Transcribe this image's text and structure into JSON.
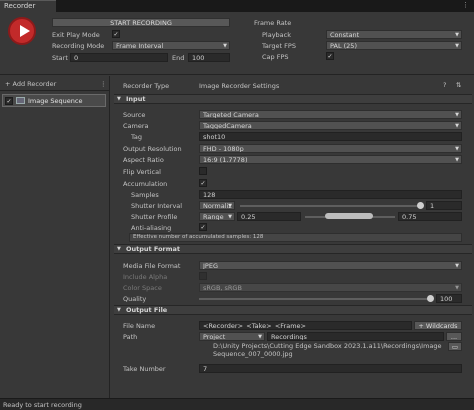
{
  "tab": {
    "title": "Recorder"
  },
  "top": {
    "start_label": "START RECORDING",
    "exit_play_mode_label": "Exit Play Mode",
    "recording_mode_label": "Recording Mode",
    "recording_mode_value": "Frame Interval",
    "start_label_short": "Start",
    "start_value": "0",
    "end_label": "End",
    "end_value": "100",
    "frame_rate_label": "Frame Rate",
    "playback_label": "Playback",
    "playback_value": "Constant",
    "target_fps_label": "Target FPS",
    "target_fps_value": "PAL (25)",
    "cap_fps_label": "Cap FPS"
  },
  "left": {
    "add_recorder": "+ Add Recorder",
    "items": [
      {
        "label": "Image Sequence"
      }
    ]
  },
  "right": {
    "recorder_type_label": "Recorder Type",
    "recorder_type_value": "Image Recorder Settings",
    "input_section": "Input",
    "source_label": "Source",
    "source_value": "Targeted Camera",
    "camera_label": "Camera",
    "camera_value": "TaggedCamera",
    "tag_label": "Tag",
    "tag_value": "shot10",
    "output_resolution_label": "Output Resolution",
    "output_resolution_value": "FHD - 1080p",
    "aspect_ratio_label": "Aspect Ratio",
    "aspect_ratio_value": "16:9 (1.7778)",
    "flip_vertical_label": "Flip Vertical",
    "accumulation_label": "Accumulation",
    "samples_label": "Samples",
    "samples_value": "128",
    "shutter_interval_label": "Shutter Interval",
    "shutter_interval_mode": "Normaliz",
    "shutter_interval_value": "1",
    "shutter_profile_label": "Shutter Profile",
    "shutter_profile_mode": "Range",
    "shutter_profile_min": "0.25",
    "shutter_profile_max": "0.75",
    "anti_aliasing_label": "Anti-aliasing",
    "accum_info": "Effective number of accumulated samples: 128",
    "output_format_section": "Output Format",
    "media_file_format_label": "Media File Format",
    "media_file_format_value": "JPEG",
    "include_alpha_label": "Include Alpha",
    "color_space_label": "Color Space",
    "color_space_value": "sRGB, sRGB",
    "quality_label": "Quality",
    "quality_value": "100",
    "output_file_section": "Output File",
    "file_name_label": "File Name",
    "file_name_value": "<Recorder>_<Take>_<Frame>",
    "wildcards_label": "+ Wildcards",
    "path_label": "Path",
    "path_root_value": "Project",
    "path_folder_value": "Recordings",
    "path_browse": "...",
    "path_full_line1": "D:\\Unity Projects\\Cutting Edge Sandbox 2023.1.a11\\Recordings\\Image",
    "path_full_line2": "Sequence_007_0000.jpg",
    "take_number_label": "Take Number",
    "take_number_value": "7"
  },
  "status": {
    "text": "Ready to start recording"
  },
  "colors": {
    "record_red": "#c22a2a",
    "panel_bg": "#383838",
    "field_bg": "#2a2a2a"
  }
}
